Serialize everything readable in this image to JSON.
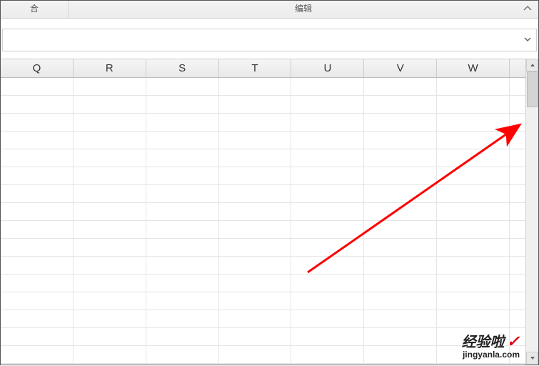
{
  "ribbon": {
    "group1": "合",
    "group2": "编辑"
  },
  "columns": [
    "Q",
    "R",
    "S",
    "T",
    "U",
    "V",
    "W",
    ""
  ],
  "rowCount": 16,
  "watermark": {
    "main": "经验啦",
    "check": "✓",
    "sub": "jingyanla.com"
  }
}
